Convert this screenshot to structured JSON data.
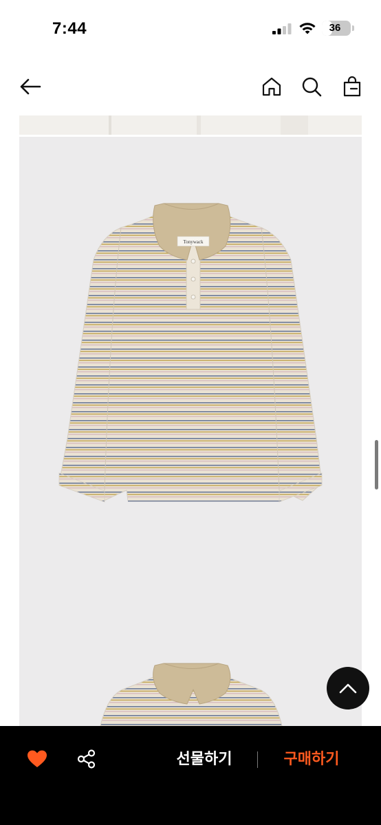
{
  "status_bar": {
    "time": "7:44",
    "battery_level": "36",
    "battery_fraction": 0.36
  },
  "header": {
    "back_icon": "arrow-left-icon",
    "home_icon": "home-icon",
    "search_icon": "search-icon",
    "bag_icon": "shopping-bag-icon"
  },
  "product_image": {
    "brand_tag": "Tonywack",
    "colors": {
      "background": "#ecebec",
      "collar": "#cdbb98",
      "body": "#eae2d3",
      "stripe_1": "#6b7a99",
      "stripe_2": "#c5a95a",
      "stripe_3": "#d8bcc0"
    }
  },
  "scroll_top_icon": "chevron-up-icon",
  "bottom_bar": {
    "like_icon": "heart-icon",
    "share_icon": "share-icon",
    "gift_label": "선물하기",
    "buy_label": "구매하기",
    "like_color": "#ff5a1f",
    "buy_color": "#ff5a1f"
  }
}
